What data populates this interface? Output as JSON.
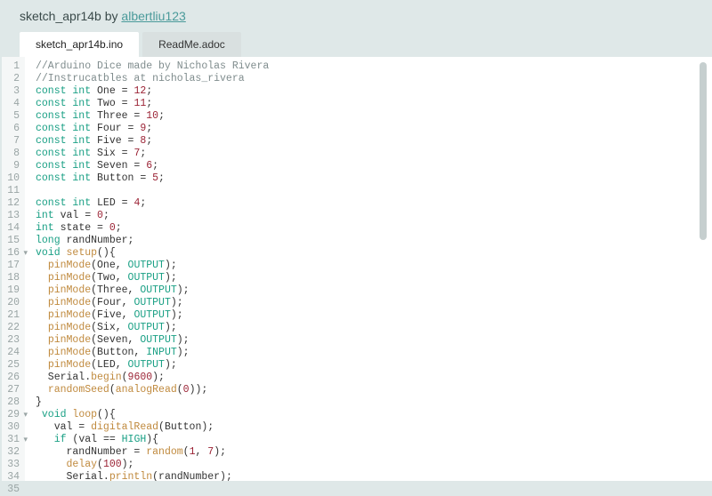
{
  "header": {
    "title_prefix": "sketch_apr14b",
    "by": " by ",
    "author": "albertliu123"
  },
  "tabs": [
    {
      "label": "sketch_apr14b.ino",
      "active": true
    },
    {
      "label": "ReadMe.adoc",
      "active": false
    }
  ],
  "code": {
    "lines": [
      {
        "n": 1,
        "fold": false,
        "tokens": [
          {
            "t": "//Arduino Dice made by Nicholas Rivera",
            "c": "c-comment"
          }
        ]
      },
      {
        "n": 2,
        "fold": false,
        "tokens": [
          {
            "t": "//Instrucatbles at nicholas_rivera",
            "c": "c-comment"
          }
        ]
      },
      {
        "n": 3,
        "fold": false,
        "tokens": [
          {
            "t": "const int",
            "c": "c-kw"
          },
          {
            "t": " One = "
          },
          {
            "t": "12",
            "c": "c-lit"
          },
          {
            "t": ";"
          }
        ]
      },
      {
        "n": 4,
        "fold": false,
        "tokens": [
          {
            "t": "const int",
            "c": "c-kw"
          },
          {
            "t": " Two = "
          },
          {
            "t": "11",
            "c": "c-lit"
          },
          {
            "t": ";"
          }
        ]
      },
      {
        "n": 5,
        "fold": false,
        "tokens": [
          {
            "t": "const int",
            "c": "c-kw"
          },
          {
            "t": " Three = "
          },
          {
            "t": "10",
            "c": "c-lit"
          },
          {
            "t": ";"
          }
        ]
      },
      {
        "n": 6,
        "fold": false,
        "tokens": [
          {
            "t": "const int",
            "c": "c-kw"
          },
          {
            "t": " Four = "
          },
          {
            "t": "9",
            "c": "c-lit"
          },
          {
            "t": ";"
          }
        ]
      },
      {
        "n": 7,
        "fold": false,
        "tokens": [
          {
            "t": "const int",
            "c": "c-kw"
          },
          {
            "t": " Five = "
          },
          {
            "t": "8",
            "c": "c-lit"
          },
          {
            "t": ";"
          }
        ]
      },
      {
        "n": 8,
        "fold": false,
        "tokens": [
          {
            "t": "const int",
            "c": "c-kw"
          },
          {
            "t": " Six = "
          },
          {
            "t": "7",
            "c": "c-lit"
          },
          {
            "t": ";"
          }
        ]
      },
      {
        "n": 9,
        "fold": false,
        "tokens": [
          {
            "t": "const int",
            "c": "c-kw"
          },
          {
            "t": " Seven = "
          },
          {
            "t": "6",
            "c": "c-lit"
          },
          {
            "t": ";"
          }
        ]
      },
      {
        "n": 10,
        "fold": false,
        "tokens": [
          {
            "t": "const int",
            "c": "c-kw"
          },
          {
            "t": " Button = "
          },
          {
            "t": "5",
            "c": "c-lit"
          },
          {
            "t": ";"
          }
        ]
      },
      {
        "n": 11,
        "fold": false,
        "tokens": [
          {
            "t": ""
          }
        ]
      },
      {
        "n": 12,
        "fold": false,
        "tokens": [
          {
            "t": "const int",
            "c": "c-kw"
          },
          {
            "t": " LED = "
          },
          {
            "t": "4",
            "c": "c-lit"
          },
          {
            "t": ";"
          }
        ]
      },
      {
        "n": 13,
        "fold": false,
        "tokens": [
          {
            "t": "int",
            "c": "c-kw"
          },
          {
            "t": " val = "
          },
          {
            "t": "0",
            "c": "c-lit"
          },
          {
            "t": ";"
          }
        ]
      },
      {
        "n": 14,
        "fold": false,
        "tokens": [
          {
            "t": "int",
            "c": "c-kw"
          },
          {
            "t": " state = "
          },
          {
            "t": "0",
            "c": "c-lit"
          },
          {
            "t": ";"
          }
        ]
      },
      {
        "n": 15,
        "fold": false,
        "tokens": [
          {
            "t": "long",
            "c": "c-kw"
          },
          {
            "t": " randNumber;"
          }
        ]
      },
      {
        "n": 16,
        "fold": true,
        "tokens": [
          {
            "t": "void",
            "c": "c-kw"
          },
          {
            "t": " "
          },
          {
            "t": "setup",
            "c": "c-orange"
          },
          {
            "t": "(){"
          }
        ]
      },
      {
        "n": 17,
        "fold": false,
        "tokens": [
          {
            "t": "  "
          },
          {
            "t": "pinMode",
            "c": "c-orange"
          },
          {
            "t": "(One, "
          },
          {
            "t": "OUTPUT",
            "c": "c-const"
          },
          {
            "t": ");"
          }
        ]
      },
      {
        "n": 18,
        "fold": false,
        "tokens": [
          {
            "t": "  "
          },
          {
            "t": "pinMode",
            "c": "c-orange"
          },
          {
            "t": "(Two, "
          },
          {
            "t": "OUTPUT",
            "c": "c-const"
          },
          {
            "t": ");"
          }
        ]
      },
      {
        "n": 19,
        "fold": false,
        "tokens": [
          {
            "t": "  "
          },
          {
            "t": "pinMode",
            "c": "c-orange"
          },
          {
            "t": "(Three, "
          },
          {
            "t": "OUTPUT",
            "c": "c-const"
          },
          {
            "t": ");"
          }
        ]
      },
      {
        "n": 20,
        "fold": false,
        "tokens": [
          {
            "t": "  "
          },
          {
            "t": "pinMode",
            "c": "c-orange"
          },
          {
            "t": "(Four, "
          },
          {
            "t": "OUTPUT",
            "c": "c-const"
          },
          {
            "t": ");"
          }
        ]
      },
      {
        "n": 21,
        "fold": false,
        "tokens": [
          {
            "t": "  "
          },
          {
            "t": "pinMode",
            "c": "c-orange"
          },
          {
            "t": "(Five, "
          },
          {
            "t": "OUTPUT",
            "c": "c-const"
          },
          {
            "t": ");"
          }
        ]
      },
      {
        "n": 22,
        "fold": false,
        "tokens": [
          {
            "t": "  "
          },
          {
            "t": "pinMode",
            "c": "c-orange"
          },
          {
            "t": "(Six, "
          },
          {
            "t": "OUTPUT",
            "c": "c-const"
          },
          {
            "t": ");"
          }
        ]
      },
      {
        "n": 23,
        "fold": false,
        "tokens": [
          {
            "t": "  "
          },
          {
            "t": "pinMode",
            "c": "c-orange"
          },
          {
            "t": "(Seven, "
          },
          {
            "t": "OUTPUT",
            "c": "c-const"
          },
          {
            "t": ");"
          }
        ]
      },
      {
        "n": 24,
        "fold": false,
        "tokens": [
          {
            "t": "  "
          },
          {
            "t": "pinMode",
            "c": "c-orange"
          },
          {
            "t": "(Button, "
          },
          {
            "t": "INPUT",
            "c": "c-const"
          },
          {
            "t": ");"
          }
        ]
      },
      {
        "n": 25,
        "fold": false,
        "tokens": [
          {
            "t": "  "
          },
          {
            "t": "pinMode",
            "c": "c-orange"
          },
          {
            "t": "(LED, "
          },
          {
            "t": "OUTPUT",
            "c": "c-const"
          },
          {
            "t": ");"
          }
        ]
      },
      {
        "n": 26,
        "fold": false,
        "tokens": [
          {
            "t": "  Serial."
          },
          {
            "t": "begin",
            "c": "c-orange"
          },
          {
            "t": "("
          },
          {
            "t": "9600",
            "c": "c-lit"
          },
          {
            "t": ");"
          }
        ]
      },
      {
        "n": 27,
        "fold": false,
        "tokens": [
          {
            "t": "  "
          },
          {
            "t": "randomSeed",
            "c": "c-orange"
          },
          {
            "t": "("
          },
          {
            "t": "analogRead",
            "c": "c-orange"
          },
          {
            "t": "("
          },
          {
            "t": "0",
            "c": "c-lit"
          },
          {
            "t": "));"
          }
        ]
      },
      {
        "n": 28,
        "fold": false,
        "tokens": [
          {
            "t": "}"
          }
        ]
      },
      {
        "n": 29,
        "fold": true,
        "tokens": [
          {
            "t": " "
          },
          {
            "t": "void",
            "c": "c-kw"
          },
          {
            "t": " "
          },
          {
            "t": "loop",
            "c": "c-orange"
          },
          {
            "t": "(){"
          }
        ]
      },
      {
        "n": 30,
        "fold": false,
        "tokens": [
          {
            "t": "   val = "
          },
          {
            "t": "digitalRead",
            "c": "c-orange"
          },
          {
            "t": "(Button);"
          }
        ]
      },
      {
        "n": 31,
        "fold": true,
        "tokens": [
          {
            "t": "   "
          },
          {
            "t": "if",
            "c": "c-kw"
          },
          {
            "t": " (val == "
          },
          {
            "t": "HIGH",
            "c": "c-const"
          },
          {
            "t": "){"
          }
        ]
      },
      {
        "n": 32,
        "fold": false,
        "tokens": [
          {
            "t": "     randNumber = "
          },
          {
            "t": "random",
            "c": "c-orange"
          },
          {
            "t": "("
          },
          {
            "t": "1",
            "c": "c-lit"
          },
          {
            "t": ", "
          },
          {
            "t": "7",
            "c": "c-lit"
          },
          {
            "t": ");"
          }
        ]
      },
      {
        "n": 33,
        "fold": false,
        "tokens": [
          {
            "t": "     "
          },
          {
            "t": "delay",
            "c": "c-orange"
          },
          {
            "t": "("
          },
          {
            "t": "100",
            "c": "c-lit"
          },
          {
            "t": ");"
          }
        ]
      },
      {
        "n": 34,
        "fold": false,
        "tokens": [
          {
            "t": "     Serial."
          },
          {
            "t": "println",
            "c": "c-orange"
          },
          {
            "t": "(randNumber);"
          }
        ]
      },
      {
        "n": 35,
        "fold": false,
        "tokens": [
          {
            "t": ""
          }
        ]
      }
    ]
  }
}
